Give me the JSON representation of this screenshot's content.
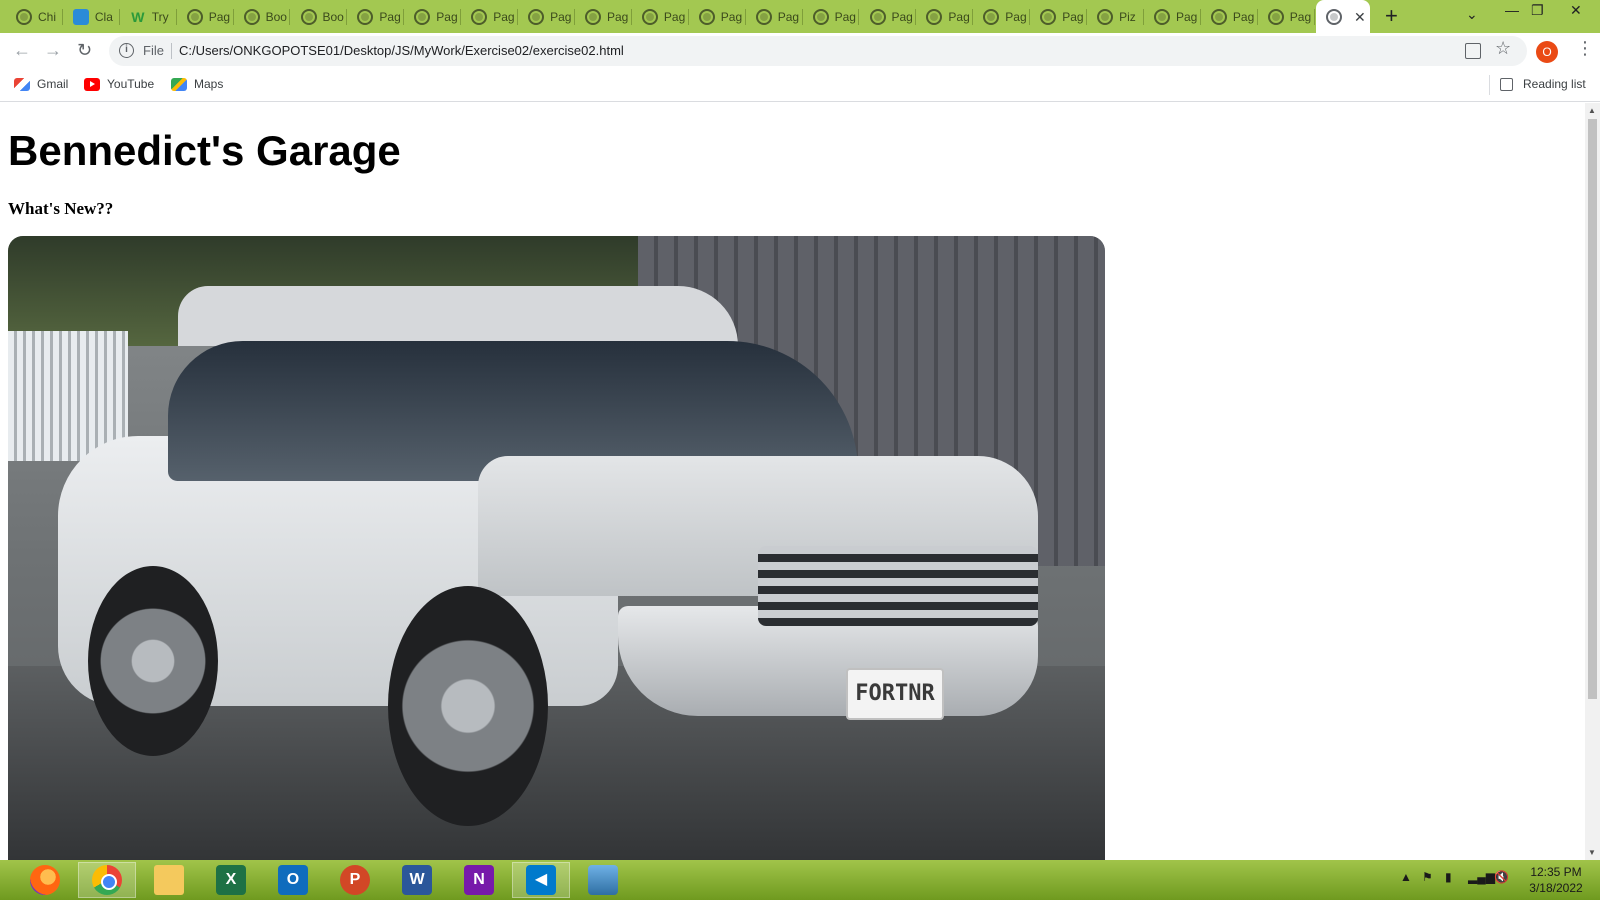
{
  "tabs": [
    {
      "label": "Chi",
      "icon": "chrome-tab-icon"
    },
    {
      "label": "Cla",
      "icon": "classroom-icon"
    },
    {
      "label": "Try",
      "icon": "w3schools-icon"
    },
    {
      "label": "Pag",
      "icon": "globe-icon"
    },
    {
      "label": "Boo",
      "icon": "globe-icon"
    },
    {
      "label": "Boo",
      "icon": "globe-icon"
    },
    {
      "label": "Pag",
      "icon": "globe-icon"
    },
    {
      "label": "Pag",
      "icon": "globe-icon"
    },
    {
      "label": "Pag",
      "icon": "globe-icon"
    },
    {
      "label": "Pag",
      "icon": "globe-icon"
    },
    {
      "label": "Pag",
      "icon": "globe-icon"
    },
    {
      "label": "Pag",
      "icon": "globe-icon"
    },
    {
      "label": "Pag",
      "icon": "globe-icon"
    },
    {
      "label": "Pag",
      "icon": "globe-icon"
    },
    {
      "label": "Pag",
      "icon": "globe-icon"
    },
    {
      "label": "Pag",
      "icon": "globe-icon"
    },
    {
      "label": "Pag",
      "icon": "globe-icon"
    },
    {
      "label": "Pag",
      "icon": "globe-icon"
    },
    {
      "label": "Pag",
      "icon": "globe-icon"
    },
    {
      "label": "Piz",
      "icon": "globe-icon"
    },
    {
      "label": "Pag",
      "icon": "globe-icon"
    },
    {
      "label": "Pag",
      "icon": "globe-icon"
    },
    {
      "label": "Pag",
      "icon": "globe-icon"
    }
  ],
  "active_tab": {
    "icon": "globe-icon",
    "close": "✕"
  },
  "toolbar": {
    "back": "←",
    "forward": "→",
    "reload": "↻",
    "info": "i",
    "scheme_label": "File",
    "url": "C:/Users/ONKGOPOTSE01/Desktop/JS/MyWork/Exercise02/exercise02.html",
    "star": "☆",
    "profile_initial": "O",
    "menu": "⋮"
  },
  "bookmarks": {
    "items": [
      {
        "label": "Gmail",
        "icon": "gmail-icon"
      },
      {
        "label": "YouTube",
        "icon": "youtube-icon"
      },
      {
        "label": "Maps",
        "icon": "maps-icon"
      }
    ],
    "reading_list": "Reading list"
  },
  "page": {
    "title": "Bennedict's Garage",
    "subheading": "What's New??",
    "plate_text": "FORTNR"
  },
  "taskbar": {
    "apps": [
      {
        "name": "firefox",
        "glyph": ""
      },
      {
        "name": "chrome",
        "glyph": "",
        "active": true
      },
      {
        "name": "file-explorer",
        "glyph": ""
      },
      {
        "name": "excel",
        "glyph": "X"
      },
      {
        "name": "outlook",
        "glyph": "O"
      },
      {
        "name": "powerpoint",
        "glyph": "P"
      },
      {
        "name": "word",
        "glyph": "W"
      },
      {
        "name": "onenote",
        "glyph": "N"
      },
      {
        "name": "vscode",
        "glyph": "◀",
        "active": true
      },
      {
        "name": "photos",
        "glyph": ""
      }
    ],
    "time": "12:35 PM",
    "date": "3/18/2022"
  },
  "colors": {
    "tab_strip": "#a3c851",
    "taskbar": "#8db43a",
    "profile": "#ea4a15"
  }
}
